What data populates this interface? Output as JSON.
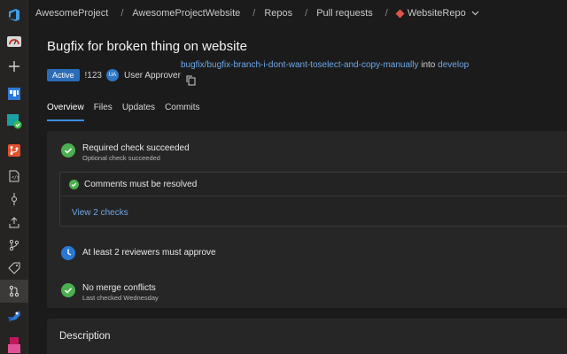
{
  "breadcrumb": {
    "items": [
      "AwesomeProject",
      "AwesomeProjectWebsite",
      "Repos",
      "Pull requests"
    ],
    "repo": "WebsiteRepo",
    "separator": "/"
  },
  "pr": {
    "title": "Bugfix for broken thing on website",
    "status": "Active",
    "id": "!123",
    "avatar_initials": "UA",
    "approver": "User Approver",
    "source_branch": "bugfix/bugfix-branch-i-dont-want-toselect-and-copy-manually",
    "into_text": "into",
    "target_branch": "develop"
  },
  "tabs": [
    {
      "label": "Overview",
      "active": true
    },
    {
      "label": "Files",
      "active": false
    },
    {
      "label": "Updates",
      "active": false
    },
    {
      "label": "Commits",
      "active": false
    }
  ],
  "checks": {
    "required": {
      "title": "Required check succeeded",
      "subtitle": "Optional check succeeded"
    },
    "comments": {
      "title": "Comments must be resolved"
    },
    "view_checks": "View 2 checks",
    "reviewers": {
      "title": "At least 2 reviewers must approve"
    },
    "merge": {
      "title": "No merge conflicts",
      "subtitle": "Last checked Wednesday"
    }
  },
  "description": {
    "title": "Description"
  },
  "colors": {
    "accent": "#3a8de0",
    "success": "#4caf50",
    "link": "#6fa8e8",
    "badge": "#2b6cb8",
    "repo_icon": "#e0534b"
  },
  "rail_icons": [
    "azure-devops-logo-icon",
    "overview-icon",
    "add-icon",
    "boards-icon",
    "test-plans-icon",
    "repos-icon",
    "files-icon",
    "commits-icon",
    "pushes-icon",
    "branches-icon",
    "tags-icon",
    "pull-requests-icon",
    "pipelines-icon",
    "artifacts-icon"
  ]
}
